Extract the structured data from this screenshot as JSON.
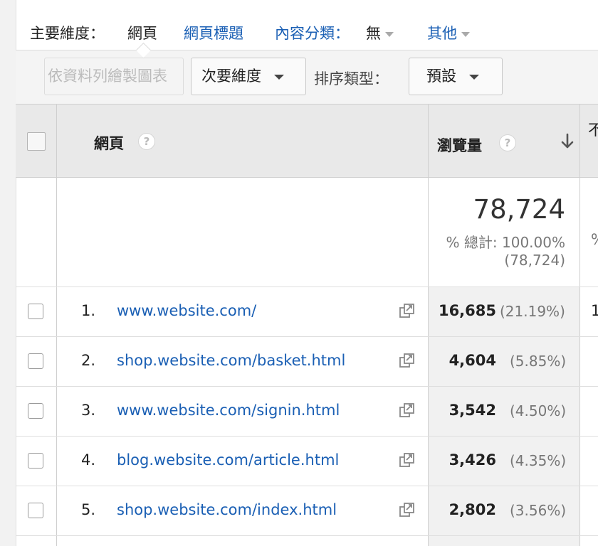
{
  "primary_dimension": {
    "label": "主要維度：",
    "active": "網頁",
    "links": [
      {
        "label": "網頁標題"
      },
      {
        "label": "內容分類："
      },
      {
        "label": "其他"
      }
    ],
    "content_grouping_value": "無"
  },
  "toolbar": {
    "plot_rows": "依資料列繪製圖表",
    "secondary_dimension": "次要維度",
    "sort_type_label": "排序類型：",
    "sort_type_value": "預設"
  },
  "table": {
    "columns": {
      "page": "網頁",
      "views": "瀏覽量",
      "next_col_cut": "不"
    },
    "help_glyph": "?",
    "summary": {
      "views_total": "78,724",
      "views_pct": "% 總計: 100.00%",
      "views_abs": "(78,724)",
      "next_col_cut": "%"
    },
    "rows": [
      {
        "num": "1.",
        "page": "www.website.com/",
        "views": "16,685",
        "pct": "(21.19%)",
        "next_cut": "1"
      },
      {
        "num": "2.",
        "page": "shop.website.com/basket.html",
        "views": "4,604",
        "pct": "(5.85%)",
        "next_cut": ""
      },
      {
        "num": "3.",
        "page": "www.website.com/signin.html",
        "views": "3,542",
        "pct": "(4.50%)",
        "next_cut": ""
      },
      {
        "num": "4.",
        "page": "blog.website.com/article.html",
        "views": "3,426",
        "pct": "(4.35%)",
        "next_cut": ""
      },
      {
        "num": "5.",
        "page": "shop.website.com/index.html",
        "views": "2,802",
        "pct": "(3.56%)",
        "next_cut": ""
      }
    ]
  },
  "colors": {
    "link": "#1a5fb4",
    "header_bg": "#e9e9e9",
    "toolbar_bg": "#f4f4f4"
  }
}
